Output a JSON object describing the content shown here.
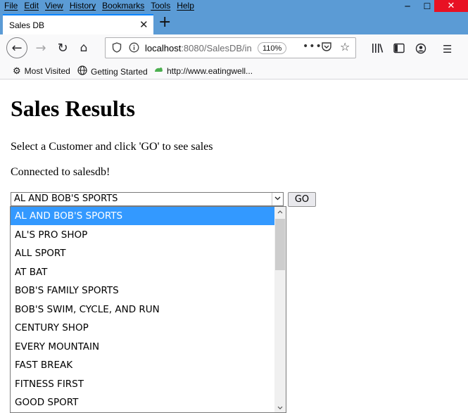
{
  "menu": [
    "File",
    "Edit",
    "View",
    "History",
    "Bookmarks",
    "Tools",
    "Help"
  ],
  "window_controls": {
    "minimize": "─",
    "maximize": "☐",
    "close": "✕"
  },
  "tab": {
    "title": "Sales DB",
    "close": "✕",
    "new_tab": "+"
  },
  "nav": {
    "back": "←",
    "forward": "→",
    "reload": "↻",
    "home": "⌂",
    "url_host": "localhost",
    "url_path": ":8080/SalesDB/in",
    "zoom": "110%",
    "more": "•••",
    "pocket": "⛉",
    "star": "☆",
    "library": "|||\\",
    "sidebar": "▥",
    "account": "◉",
    "menu": "☰"
  },
  "bookmarks": [
    {
      "icon": "gear-icon",
      "glyph": "⚙",
      "label": "Most Visited"
    },
    {
      "icon": "globe-icon",
      "glyph": "🌐",
      "label": "Getting Started"
    },
    {
      "icon": "green-bookmark-icon",
      "glyph": "☁",
      "label": "http://www.eatingwell..."
    }
  ],
  "page": {
    "title": "Sales Results",
    "instruction": "Select a Customer and click 'GO' to see sales",
    "status": "Connected to salesdb!",
    "go_label": "GO"
  },
  "customer_select": {
    "selected": "AL AND BOB'S SPORTS",
    "options": [
      "AL AND BOB'S SPORTS",
      "AL'S PRO SHOP",
      "ALL SPORT",
      "AT BAT",
      "BOB'S FAMILY SPORTS",
      "BOB'S SWIM, CYCLE, AND RUN",
      "CENTURY SHOP",
      "EVERY MOUNTAIN",
      "FAST BREAK",
      "FITNESS FIRST",
      "GOOD SPORT"
    ]
  },
  "colors": {
    "titlebar": "#5b9bd5",
    "close_button": "#e81123",
    "selection": "#3399ff",
    "active_tab_accent": "#0a84ff"
  }
}
